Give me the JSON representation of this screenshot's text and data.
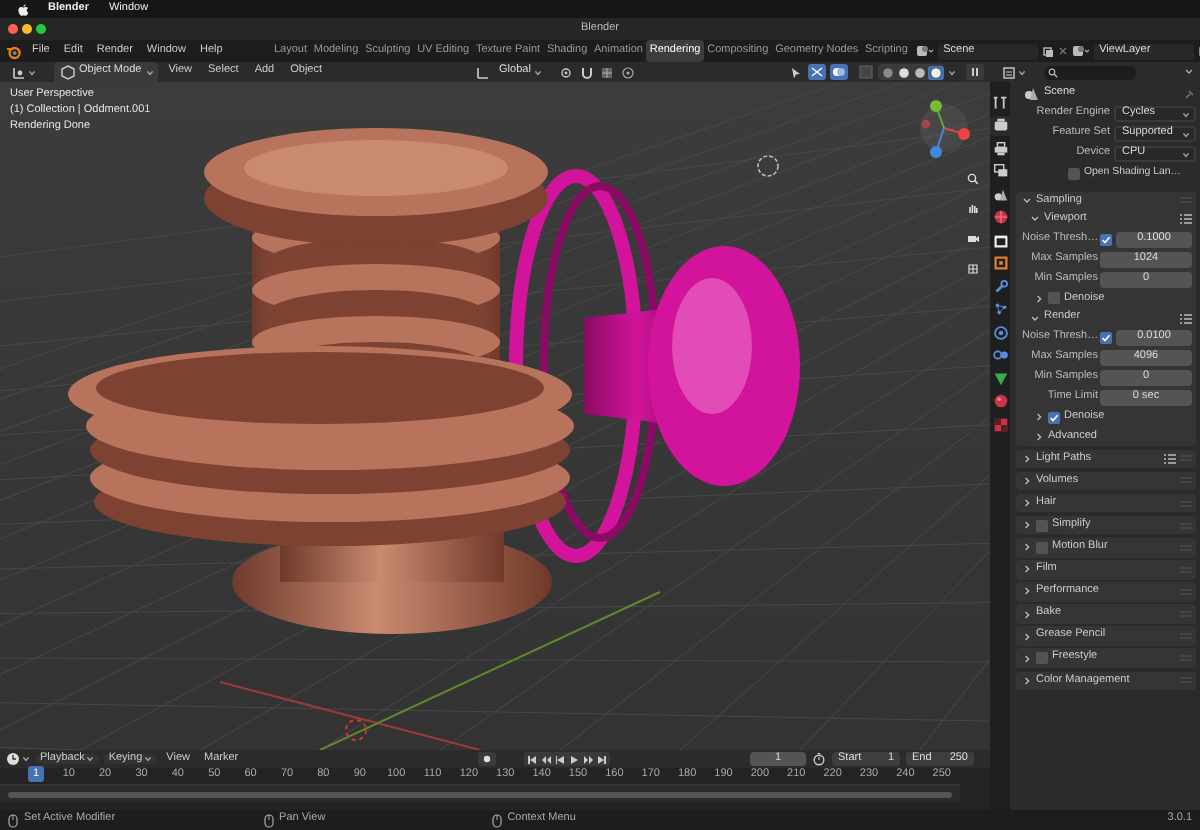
{
  "menubar": {
    "app": "Blender",
    "menus": [
      "Window"
    ]
  },
  "window": {
    "title": "Blender"
  },
  "topbar": {
    "menus": [
      "File",
      "Edit",
      "Render",
      "Window",
      "Help"
    ],
    "workspaces": [
      {
        "label": "Layout",
        "selected": false
      },
      {
        "label": "Modeling",
        "selected": false
      },
      {
        "label": "Sculpting",
        "selected": false
      },
      {
        "label": "UV Editing",
        "selected": false
      },
      {
        "label": "Texture Paint",
        "selected": false
      },
      {
        "label": "Shading",
        "selected": false
      },
      {
        "label": "Animation",
        "selected": false
      },
      {
        "label": "Rendering",
        "selected": true
      },
      {
        "label": "Compositing",
        "selected": false
      },
      {
        "label": "Geometry Nodes",
        "selected": false
      },
      {
        "label": "Scripting",
        "selected": false
      }
    ],
    "scene": "Scene",
    "view_layer": "ViewLayer"
  },
  "viewport_header": {
    "mode": "Object Mode",
    "menus": [
      "View",
      "Select",
      "Add",
      "Object"
    ],
    "orientation": "Global",
    "shading": [
      {
        "selected": false
      },
      {
        "selected": false
      },
      {
        "selected": false
      },
      {
        "selected": true
      }
    ]
  },
  "viewport": {
    "info": [
      "User Perspective",
      "(1) Collection | Oddment.001",
      "Rendering Done"
    ]
  },
  "properties": {
    "tabs": [
      {
        "selected": false
      },
      {
        "selected": true
      },
      {
        "selected": false
      },
      {
        "selected": false
      },
      {
        "selected": false
      },
      {
        "selected": false
      },
      {
        "selected": false
      },
      {
        "selected": false
      },
      {
        "selected": false
      },
      {
        "selected": false
      },
      {
        "selected": false
      },
      {
        "selected": false
      },
      {
        "selected": false
      },
      {
        "selected": false
      },
      {
        "selected": false
      }
    ],
    "context": "Scene",
    "fields": [
      {
        "label": "Render Engine",
        "value": "Cycles"
      },
      {
        "label": "Feature Set",
        "value": "Supported"
      },
      {
        "label": "Device",
        "value": "CPU"
      }
    ],
    "options": [
      {
        "label": "Open Shading Lan…",
        "checked": false
      }
    ],
    "panels": [
      {
        "label": "Sampling",
        "expanded": true,
        "children": [
          {
            "kind": "subpanel",
            "label": "Viewport",
            "expanded": true,
            "presets": true,
            "children": [
              {
                "kind": "check_value",
                "label": "Noise Thresh…",
                "checked": true,
                "value": "0.1000"
              },
              {
                "kind": "value",
                "label": "Max Samples",
                "value": "1024"
              },
              {
                "kind": "value",
                "label": "Min Samples",
                "value": "0"
              },
              {
                "kind": "subpanel",
                "label": "Denoise",
                "expanded": false,
                "checked": false
              }
            ]
          },
          {
            "kind": "subpanel",
            "label": "Render",
            "expanded": true,
            "presets": true,
            "children": [
              {
                "kind": "check_value",
                "label": "Noise Thresh…",
                "checked": true,
                "value": "0.0100"
              },
              {
                "kind": "value",
                "label": "Max Samples",
                "value": "4096"
              },
              {
                "kind": "value",
                "label": "Min Samples",
                "value": "0"
              },
              {
                "kind": "value",
                "label": "Time Limit",
                "value": "0 sec"
              },
              {
                "kind": "subpanel",
                "label": "Denoise",
                "expanded": false,
                "checked": true
              },
              {
                "kind": "subpanel",
                "label": "Advanced",
                "expanded": false
              }
            ]
          }
        ]
      },
      {
        "label": "Light Paths",
        "expanded": false,
        "presets": true
      },
      {
        "label": "Volumes",
        "expanded": false
      },
      {
        "label": "Hair",
        "expanded": false
      },
      {
        "label": "Simplify",
        "expanded": false,
        "checked": false
      },
      {
        "label": "Motion Blur",
        "expanded": false,
        "checked": false
      },
      {
        "label": "Film",
        "expanded": false
      },
      {
        "label": "Performance",
        "expanded": false
      },
      {
        "label": "Bake",
        "expanded": false
      },
      {
        "label": "Grease Pencil",
        "expanded": false
      },
      {
        "label": "Freestyle",
        "expanded": false,
        "checked": false
      },
      {
        "label": "Color Management",
        "expanded": false
      }
    ]
  },
  "timeline": {
    "menus": [
      "Playback",
      "Keying",
      "View",
      "Marker"
    ],
    "frames": [
      {
        "label": "1",
        "selected": true
      },
      {
        "label": "10",
        "selected": false
      },
      {
        "label": "20",
        "selected": false
      },
      {
        "label": "30",
        "selected": false
      },
      {
        "label": "40",
        "selected": false
      },
      {
        "label": "50",
        "selected": false
      },
      {
        "label": "60",
        "selected": false
      },
      {
        "label": "70",
        "selected": false
      },
      {
        "label": "80",
        "selected": false
      },
      {
        "label": "90",
        "selected": false
      },
      {
        "label": "100",
        "selected": false
      },
      {
        "label": "110",
        "selected": false
      },
      {
        "label": "120",
        "selected": false
      },
      {
        "label": "130",
        "selected": false
      },
      {
        "label": "140",
        "selected": false
      },
      {
        "label": "150",
        "selected": false
      },
      {
        "label": "160",
        "selected": false
      },
      {
        "label": "170",
        "selected": false
      },
      {
        "label": "180",
        "selected": false
      },
      {
        "label": "190",
        "selected": false
      },
      {
        "label": "200",
        "selected": false
      },
      {
        "label": "210",
        "selected": false
      },
      {
        "label": "220",
        "selected": false
      },
      {
        "label": "230",
        "selected": false
      },
      {
        "label": "240",
        "selected": false
      },
      {
        "label": "250",
        "selected": false
      }
    ],
    "current_frame": "1",
    "start_label": "Start",
    "start": "1",
    "end_label": "End",
    "end": "250"
  },
  "status_bar": {
    "hints": [
      "Set Active Modifier",
      "Pan View",
      "Context Menu"
    ],
    "version": "3.0.1"
  }
}
